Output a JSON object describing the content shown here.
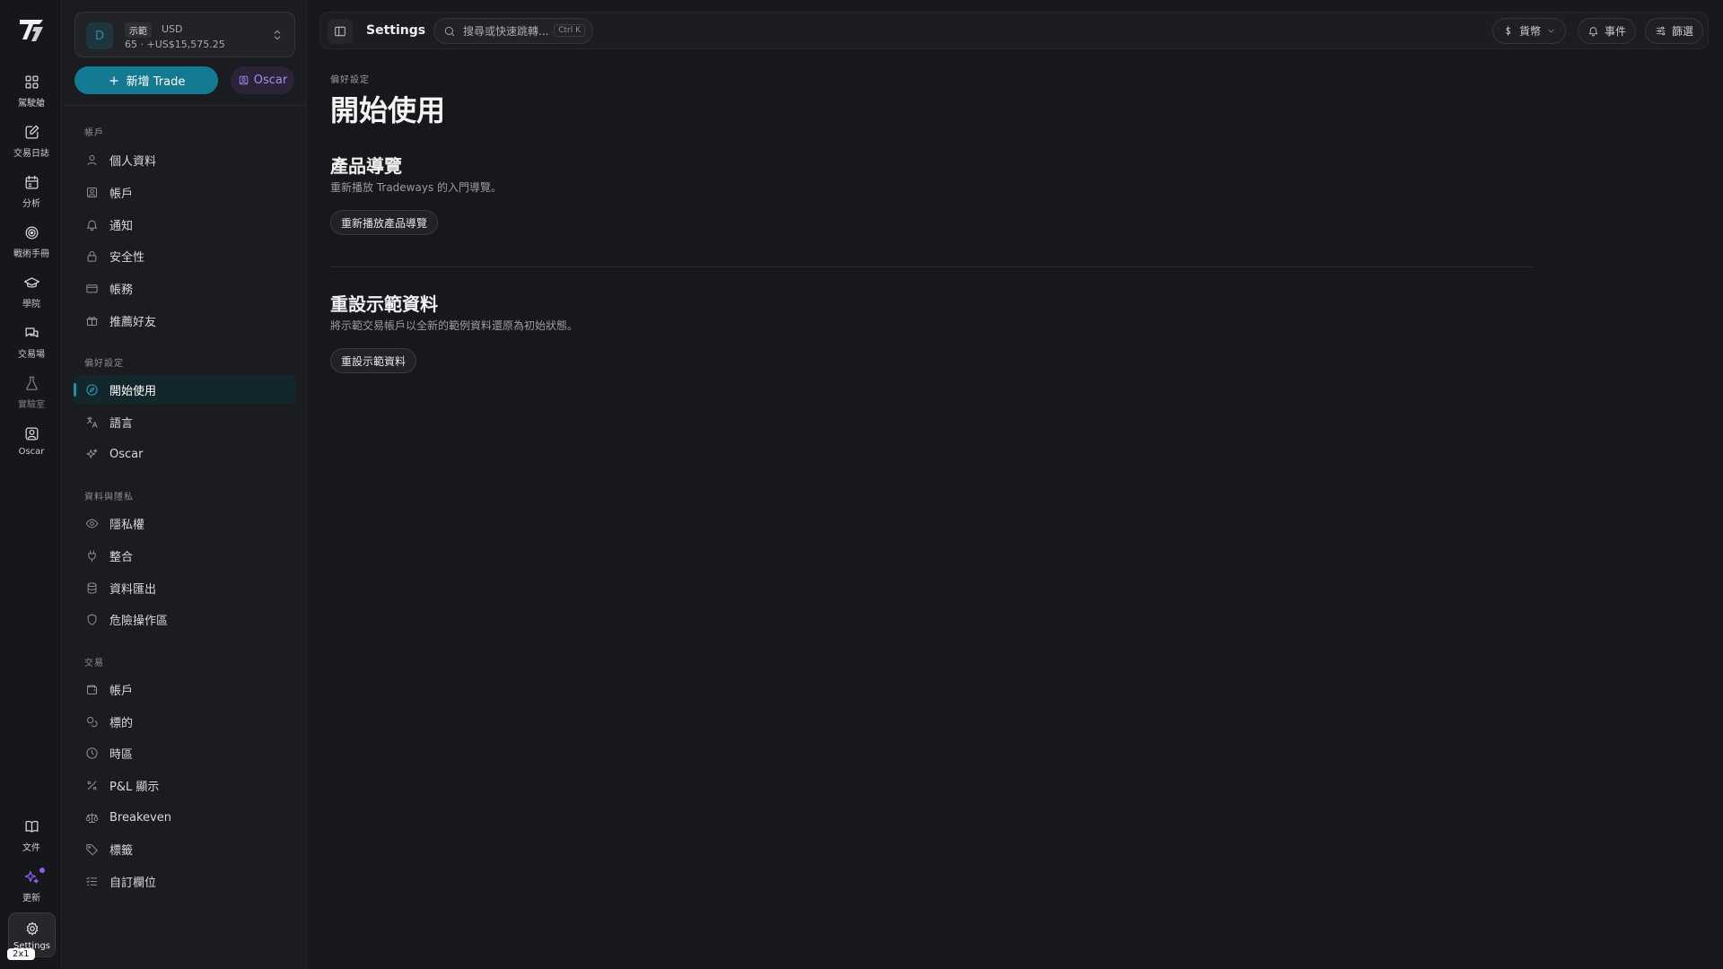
{
  "rail": {
    "items": [
      {
        "label": "駕駛艙",
        "icon": "dashboard-icon"
      },
      {
        "label": "交易日誌",
        "icon": "journal-edit-icon"
      },
      {
        "label": "分析",
        "icon": "calendar-icon"
      },
      {
        "label": "戰術手冊",
        "icon": "target-icon"
      },
      {
        "label": "學院",
        "icon": "graduation-cap-icon"
      },
      {
        "label": "交易場",
        "icon": "chat-icon"
      },
      {
        "label": "實驗室",
        "icon": "flask-icon"
      },
      {
        "label": "Oscar",
        "icon": "oscar-icon"
      }
    ],
    "bottom": [
      {
        "label": "文件",
        "icon": "book-icon"
      },
      {
        "label": "更新",
        "icon": "sparkles-icon"
      }
    ],
    "settings_label": "Settings",
    "zoom_badge": "2x1"
  },
  "account": {
    "avatar": "D",
    "demo_badge": "示範",
    "currency": "USD",
    "balance": "65 · +US$15,575.25"
  },
  "actions": {
    "new_trade": "新增 Trade",
    "oscar": "Oscar"
  },
  "sidebar": {
    "sections": [
      {
        "title": "帳戶",
        "items": [
          {
            "label": "個人資料",
            "icon": "user-icon"
          },
          {
            "label": "帳戶",
            "icon": "account-card-icon"
          },
          {
            "label": "通知",
            "icon": "bell-icon"
          },
          {
            "label": "安全性",
            "icon": "lock-icon"
          },
          {
            "label": "帳務",
            "icon": "credit-card-icon"
          },
          {
            "label": "推薦好友",
            "icon": "gift-icon"
          }
        ]
      },
      {
        "title": "偏好設定",
        "items": [
          {
            "label": "開始使用",
            "icon": "compass-icon",
            "active": true
          },
          {
            "label": "語言",
            "icon": "translate-icon"
          },
          {
            "label": "Oscar",
            "icon": "sparkles-icon"
          }
        ]
      },
      {
        "title": "資料與隱私",
        "items": [
          {
            "label": "隱私權",
            "icon": "eye-icon"
          },
          {
            "label": "整合",
            "icon": "plug-icon"
          },
          {
            "label": "資料匯出",
            "icon": "database-icon"
          },
          {
            "label": "危險操作區",
            "icon": "shield-icon"
          }
        ]
      },
      {
        "title": "交易",
        "items": [
          {
            "label": "帳戶",
            "icon": "wallet-icon"
          },
          {
            "label": "標的",
            "icon": "coins-icon"
          },
          {
            "label": "時區",
            "icon": "clock-icon"
          },
          {
            "label": "P&L 顯示",
            "icon": "percent-icon"
          },
          {
            "label": "Breakeven",
            "icon": "scale-icon"
          },
          {
            "label": "標籤",
            "icon": "tag-icon"
          },
          {
            "label": "自訂欄位",
            "icon": "list-check-icon"
          }
        ]
      }
    ]
  },
  "topbar": {
    "title": "Settings",
    "search_placeholder": "搜尋或快速跳轉...",
    "search_shortcut": "Ctrl K",
    "currency_label": "貨幣",
    "events_label": "事件",
    "filter_label": "篩選"
  },
  "main": {
    "eyebrow": "偏好設定",
    "title": "開始使用",
    "tour": {
      "title": "產品導覽",
      "desc": "重新播放 Tradeways 的入門導覽。",
      "button": "重新播放產品導覽"
    },
    "reset": {
      "title": "重設示範資料",
      "desc": "將示範交易帳戶以全新的範例資料還原為初始狀態。",
      "button": "重設示範資料"
    }
  }
}
